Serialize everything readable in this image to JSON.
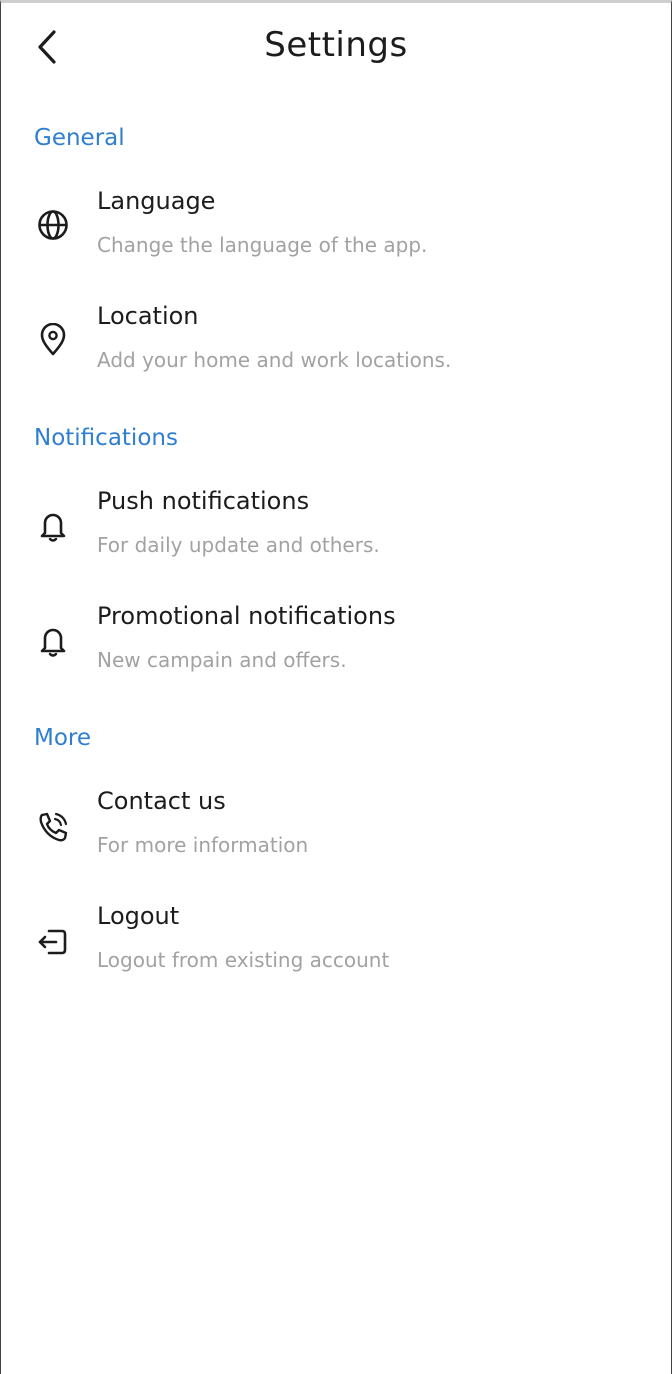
{
  "header": {
    "title": "Settings",
    "back_icon": "chevron-left-icon"
  },
  "accent_color": "#2f7fd0",
  "sections": [
    {
      "title": "General",
      "items": [
        {
          "label": "Language",
          "description": "Change the language of the app.",
          "icon": "globe-icon"
        },
        {
          "label": "Location",
          "description": "Add your home and work locations.",
          "icon": "location-pin-icon"
        }
      ]
    },
    {
      "title": "Notifications",
      "items": [
        {
          "label": "Push notifications",
          "description": "For daily update and others.",
          "icon": "bell-icon"
        },
        {
          "label": "Promotional notifications",
          "description": "New campain and offers.",
          "icon": "bell-icon"
        }
      ]
    },
    {
      "title": "More",
      "items": [
        {
          "label": "Contact us",
          "description": "For more information",
          "icon": "phone-icon"
        },
        {
          "label": "Logout",
          "description": "Logout from existing account",
          "icon": "logout-icon"
        }
      ]
    }
  ]
}
